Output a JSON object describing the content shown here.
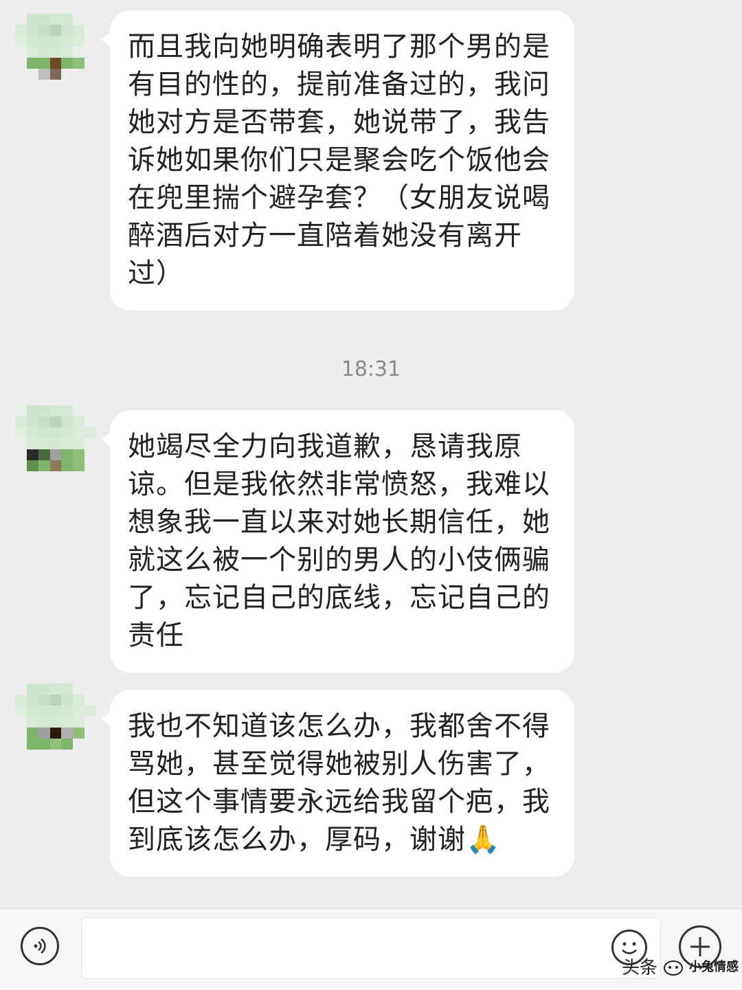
{
  "chat": {
    "messages": [
      {
        "text": "而且我向她明确表明了那个男的是有目的性的，提前准备过的，我问她对方是否带套，她说带了，我告诉她如果你们只是聚会吃个饭他会在兜里揣个避孕套？（女朋友说喝醉酒后对方一直陪着她没有离开过）"
      },
      {
        "text": "她竭尽全力向我道歉，恳请我原谅。但是我依然非常愤怒，我难以想象我一直以来对她长期信任，她就这么被一个别的男人的小伎俩骗了，忘记自己的底线，忘记自己的责任"
      },
      {
        "text": "我也不知道该怎么办，我都舍不得骂她，甚至觉得她被别人伤害了，但这个事情要永远给我留个疤，我到底该怎么办，厚码，谢谢🙏"
      }
    ],
    "timestamp": "18:31"
  },
  "watermark": {
    "brand": "头条",
    "account": "小兔情感"
  },
  "icons": {
    "voice": "voice-icon",
    "emoji": "emoji-icon",
    "plus": "plus-icon"
  }
}
